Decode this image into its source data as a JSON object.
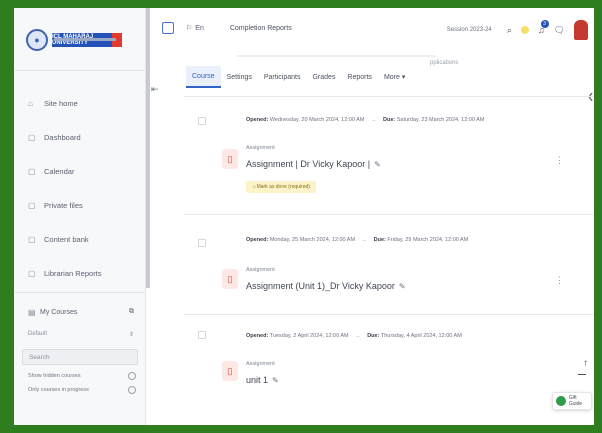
{
  "logo": {
    "text": "ICL MAHARAJ UNIVERSITY",
    "seal": "●"
  },
  "sidebar": {
    "items": [
      {
        "icon": "⌂",
        "label": "Site home"
      },
      {
        "icon": "▢",
        "label": "Dashboard"
      },
      {
        "icon": "▢",
        "label": "Calendar"
      },
      {
        "icon": "▢",
        "label": "Private files"
      },
      {
        "icon": "▢",
        "label": "Content bank"
      },
      {
        "icon": "▢",
        "label": "Librarian Reports"
      }
    ],
    "my_courses": {
      "label": "My Courses",
      "icon": "▤",
      "action": "⧉"
    },
    "filter": {
      "label": "Default",
      "action": "⇕"
    },
    "search": {
      "placeholder": "Search"
    },
    "options": [
      {
        "label": "Show hidden courses"
      },
      {
        "label": "Only courses in progress"
      }
    ]
  },
  "topbar": {
    "flag_label": "En",
    "title": "Completion Reports",
    "session": "Session 2023-24",
    "notification_count": "3"
  },
  "tabs": [
    {
      "label": "Course",
      "active": true
    },
    {
      "label": "Settings",
      "active": false
    },
    {
      "label": "Participants",
      "active": false
    },
    {
      "label": "Grades",
      "active": false
    },
    {
      "label": "Reports",
      "active": false
    },
    {
      "label": "More ▾",
      "active": false
    }
  ],
  "ghost_text": "pplications",
  "activities": [
    {
      "opened_label": "Opened:",
      "opened": "Wednesday, 20 March 2024, 12:00 AM",
      "due_label": "Due:",
      "due": "Saturday, 23 March 2024, 12:00 AM",
      "type": "Assignment",
      "name": "Assignment | Dr Vicky Kapoor |",
      "badge": "Mark as done (required)"
    },
    {
      "opened_label": "Opened:",
      "opened": "Monday, 25 March 2024, 12:00 AM",
      "due_label": "Due:",
      "due": "Friday, 29 March 2024, 12:00 AM",
      "type": "Assignment",
      "name": "Assignment (Unit 1)_Dr Vicky Kapoor",
      "badge": ""
    },
    {
      "opened_label": "Opened:",
      "opened": "Tuesday, 2 April 2024, 12:00 AM",
      "due_label": "Due:",
      "due": "Thursday, 4 April 2024, 12:00 AM",
      "type": "Assignment",
      "name": "unit 1",
      "badge": ""
    }
  ],
  "fab": {
    "label": "Gift Guide"
  },
  "colors": {
    "accent": "#2f63c6",
    "frame_border": "#2e7d1f",
    "assign_icon": "#d9443a"
  }
}
